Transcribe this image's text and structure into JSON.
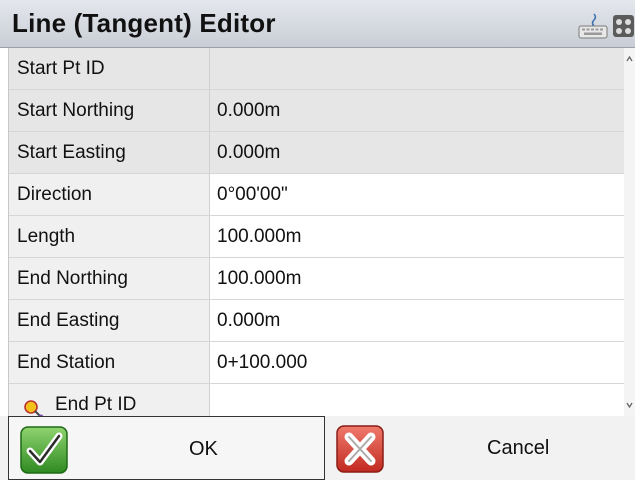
{
  "window": {
    "title": "Line (Tangent) Editor"
  },
  "header_icons": [
    "keyboard-icon",
    "menu-icon"
  ],
  "rows": [
    {
      "label": "Start Pt ID",
      "value": ""
    },
    {
      "label": "Start Northing",
      "value": "0.000m"
    },
    {
      "label": "Start Easting",
      "value": "0.000m"
    },
    {
      "label": "Direction",
      "value": "0°00'00\""
    },
    {
      "label": "Length",
      "value": "100.000m"
    },
    {
      "label": "End Northing",
      "value": "100.000m"
    },
    {
      "label": "End Easting",
      "value": "0.000m"
    },
    {
      "label": "End Station",
      "value": "0+100.000"
    },
    {
      "label": "End Pt ID",
      "value": ""
    }
  ],
  "buttons": {
    "ok": "OK",
    "cancel": "Cancel"
  },
  "colors": {
    "readonly_bg": "#e6e6e6",
    "ok_green": "#3c9a2a",
    "cancel_red": "#d63b2e"
  }
}
